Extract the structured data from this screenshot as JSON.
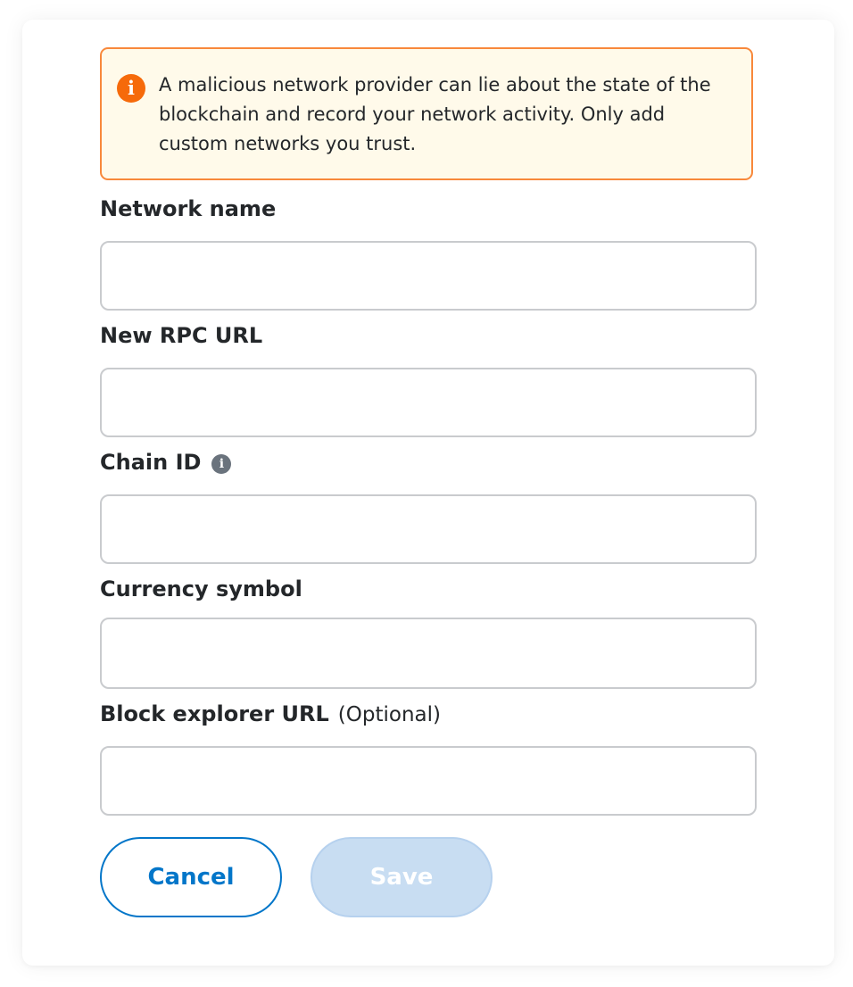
{
  "warning": {
    "icon": "alert-circle-icon",
    "text": "A malicious network provider can lie about the state of the blockchain and record your network activity. Only add custom networks you trust.",
    "border_color": "#f8883b",
    "background": "#fffaea"
  },
  "fields": {
    "network_name": {
      "label": "Network name",
      "value": ""
    },
    "rpc_url": {
      "label": "New RPC URL",
      "value": ""
    },
    "chain_id": {
      "label": "Chain ID",
      "info_icon": "i",
      "value": ""
    },
    "currency_symbol": {
      "label": "Currency symbol",
      "value": ""
    },
    "block_explorer": {
      "label": "Block explorer URL",
      "optional": "(Optional)",
      "value": ""
    }
  },
  "buttons": {
    "cancel": "Cancel",
    "save": "Save",
    "accent": "#0376c9",
    "disabled": "#c8ddf2"
  }
}
